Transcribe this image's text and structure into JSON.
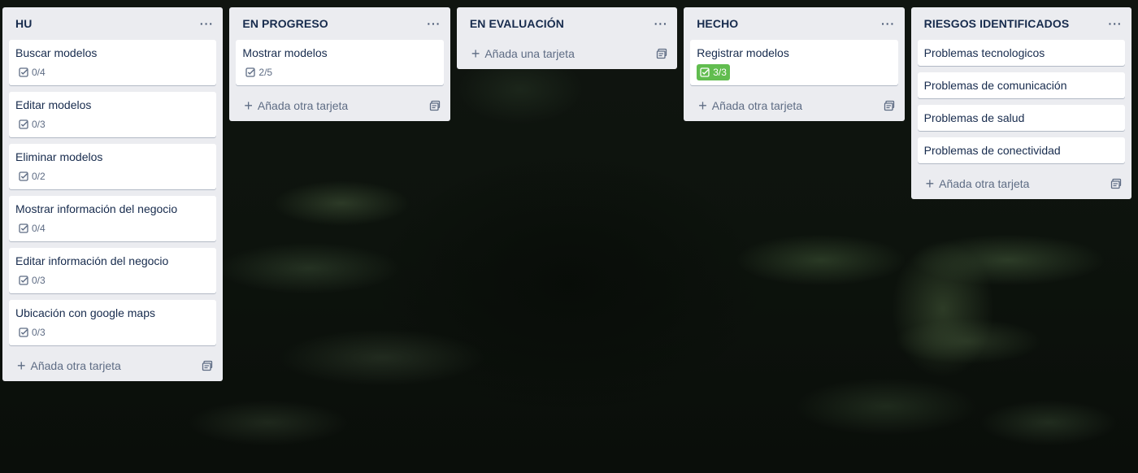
{
  "board": {
    "lists": [
      {
        "title": "HU",
        "menu_icon": "ellipsis-icon",
        "cards": [
          {
            "title": "Buscar modelos",
            "checklist": "0/4",
            "complete": false
          },
          {
            "title": "Editar modelos",
            "checklist": "0/3",
            "complete": false
          },
          {
            "title": "Eliminar modelos",
            "checklist": "0/2",
            "complete": false
          },
          {
            "title": "Mostrar información del negocio",
            "checklist": "0/4",
            "complete": false
          },
          {
            "title": "Editar información del negocio",
            "checklist": "0/3",
            "complete": false
          },
          {
            "title": "Ubicación con google maps",
            "checklist": "0/3",
            "complete": false
          }
        ],
        "add_label": "Añada otra tarjeta"
      },
      {
        "title": "EN PROGRESO",
        "menu_icon": "ellipsis-icon",
        "cards": [
          {
            "title": "Mostrar modelos",
            "checklist": "2/5",
            "complete": false
          }
        ],
        "add_label": "Añada otra tarjeta"
      },
      {
        "title": "EN EVALUACIÓN",
        "menu_icon": "ellipsis-icon",
        "cards": [],
        "add_label": "Añada una tarjeta"
      },
      {
        "title": "HECHO",
        "menu_icon": "ellipsis-icon",
        "cards": [
          {
            "title": "Registrar modelos",
            "checklist": "3/3",
            "complete": true
          }
        ],
        "add_label": "Añada otra tarjeta"
      },
      {
        "title": "RIESGOS IDENTIFICADOS",
        "menu_icon": "ellipsis-icon",
        "cards": [
          {
            "title": "Problemas tecnologicos"
          },
          {
            "title": "Problemas de comunicación"
          },
          {
            "title": "Problemas de salud"
          },
          {
            "title": "Problemas de conectividad"
          }
        ],
        "add_label": "Añada otra tarjeta"
      }
    ]
  },
  "icons": {
    "checklist": "checklist-icon",
    "add": "plus-icon",
    "template": "card-template-icon"
  },
  "colors": {
    "list_bg": "#ebecf0",
    "card_bg": "#ffffff",
    "complete_badge": "#61bd4f",
    "text": "#172b4d",
    "muted": "#5e6c84"
  }
}
